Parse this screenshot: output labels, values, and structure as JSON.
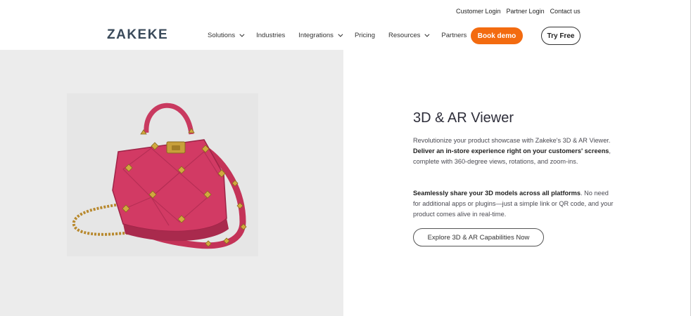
{
  "top_links": [
    "Customer Login",
    "Partner Login",
    "Contact us"
  ],
  "logo": {
    "text": "ZAKEKE"
  },
  "nav": [
    {
      "label": "Solutions",
      "dropdown": true
    },
    {
      "label": "Industries",
      "dropdown": false
    },
    {
      "label": "Integrations",
      "dropdown": true
    },
    {
      "label": "Pricing",
      "dropdown": false
    },
    {
      "label": "Resources",
      "dropdown": true
    },
    {
      "label": "Partners",
      "dropdown": true
    }
  ],
  "header": {
    "book_demo": "Book demo",
    "try_free": "Try Free"
  },
  "hero": {
    "title": "3D & AR Viewer",
    "p1_pre": "Revolutionize your product showcase with Zakeke's 3D & AR Viewer. ",
    "p1_bold": "Deliver an in-store experience right on your customers' screens",
    "p1_post": ", complete with 360-degree views, rotations, and zoom-ins.",
    "p2_bold": "Seamlessly share your 3D models across all platforms",
    "p2_post": ". No need for additional apps or plugins—just a simple link or QR code, and your product comes alive in real-time.",
    "cta": "Explore 3D & AR Capabilities Now"
  },
  "colors": {
    "accent": "#f36b10",
    "handbag": "#d23a64",
    "studs": "#c8a03a",
    "hero_bg": "#ececec"
  }
}
